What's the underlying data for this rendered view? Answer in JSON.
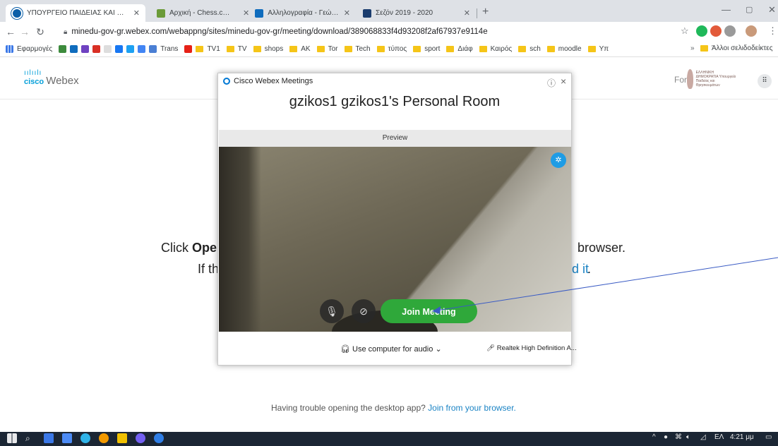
{
  "browser": {
    "tabs": [
      {
        "title": "ΥΠΟΥΡΓΕΙΟ ΠΑΙΔΕΙΑΣ ΚΑΙ ΘΡΗΣΚ",
        "active": true,
        "favicon_color": "#0b5fa8"
      },
      {
        "title": "Αρχική - Chess.com",
        "active": false,
        "favicon_color": "#6b9b38"
      },
      {
        "title": "Αλληλογραφία - Γεώργιος Ζήκος",
        "active": false,
        "favicon_color": "#0f6cbd"
      },
      {
        "title": "Σεζόν 2019 - 2020",
        "active": false,
        "favicon_color": "#1b3d6e"
      }
    ],
    "new_tab": "+",
    "url": "minedu-gov-gr.webex.com/webappng/sites/minedu-gov-gr/meeting/download/389068833f4d93208f2af67937e9114e",
    "bookmarks": [
      {
        "label": "Εφαρμογές",
        "type": "apps"
      },
      {
        "label": "Trans",
        "type": "icon"
      },
      {
        "label": "TV1",
        "type": "folder"
      },
      {
        "label": "TV",
        "type": "folder"
      },
      {
        "label": "shops",
        "type": "folder"
      },
      {
        "label": "AK",
        "type": "folder"
      },
      {
        "label": "Tor",
        "type": "folder"
      },
      {
        "label": "Tech",
        "type": "folder"
      },
      {
        "label": "τύπος",
        "type": "folder"
      },
      {
        "label": "sport",
        "type": "folder"
      },
      {
        "label": "Διάφ",
        "type": "folder"
      },
      {
        "label": "Καιρός",
        "type": "folder"
      },
      {
        "label": "sch",
        "type": "folder"
      },
      {
        "label": "moodle",
        "type": "folder"
      },
      {
        "label": "Υπ",
        "type": "folder"
      }
    ],
    "bookmarks_overflow": "»",
    "other_bookmarks": "Άλλοι σελιδοδείκτες"
  },
  "page": {
    "logo_cisco": "cisco",
    "logo_webex": "Webex",
    "for_label": "For",
    "gov_text": "ΕΛΛΗΝΙΚΗ ΔΗΜΟΚΡΑΤΙΑ Υπουργείο Παιδείας και Θρησκευμάτων",
    "click_prefix": "Click ",
    "click_bold": "Ope",
    "browser_suffix": "browser.",
    "if_prefix": "If th",
    "it_link": "d it",
    "it_dot": ".",
    "trouble_text": "Having trouble opening the desktop app? ",
    "trouble_link": "Join from your browser."
  },
  "dialog": {
    "title": "Cisco Webex Meetings",
    "help_icon": "?",
    "close_icon": "×",
    "room_name": "gzikos1 gzikos1's Personal Room",
    "preview_label": "Preview",
    "join_button": "Join Meeting",
    "audio_option": "Use computer for audio",
    "speaker_device": "Realtek High Definition A..."
  },
  "taskbar": {
    "lang": "ΕΛ",
    "time": "4:21 μμ"
  },
  "colors": {
    "join_green": "#2fa83a",
    "link_blue": "#1a83c4",
    "annotation_arrow": "#3a5bc4",
    "taskbar_bg": "#1b2634"
  }
}
